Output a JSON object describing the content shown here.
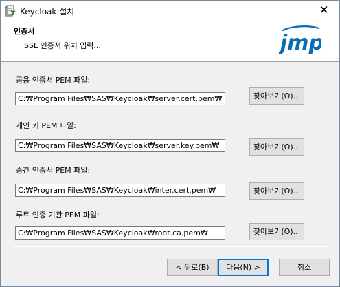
{
  "window": {
    "title": "Keycloak 설치",
    "close_glyph": "✕"
  },
  "header": {
    "title": "인증서",
    "subtitle": "SSL 인증서 위치 입력...",
    "logo_text": "jmp"
  },
  "fields": [
    {
      "label": "공용 인증서 PEM 파일:",
      "value": "C:₩Program Files₩SAS₩Keycloak₩server.cert.pem₩",
      "browse_label": "찾아보기(O)..."
    },
    {
      "label": "개인 키 PEM 파일:",
      "value": "C:₩Program Files₩SAS₩Keycloak₩server.key.pem₩",
      "browse_label": "찾아보기(O)..."
    },
    {
      "label": "중간 인증서 PEM 파일:",
      "value": "C:₩Program Files₩SAS₩Keycloak₩inter.cert.pem₩",
      "browse_label": "찾아보기(O)..."
    },
    {
      "label": "루트 인증 기관 PEM 파일:",
      "value": "C:₩Program Files₩SAS₩Keycloak₩root.ca.pem₩",
      "browse_label": "찾아보기(O)..."
    }
  ],
  "buttons": {
    "back": "< 뒤로(B)",
    "next": "다음(N) >",
    "cancel": "취소"
  },
  "colors": {
    "logo_blue": "#0b6cb5",
    "focus_blue": "#0078d7"
  },
  "icons": {
    "app": "installer-icon",
    "close": "close-icon"
  }
}
